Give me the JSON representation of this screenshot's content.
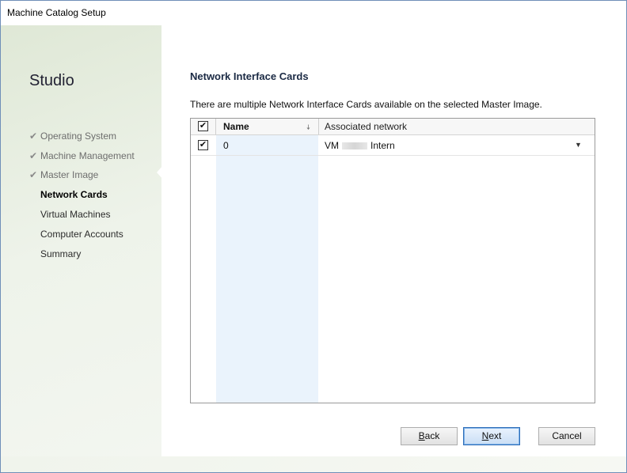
{
  "window": {
    "title": "Machine Catalog Setup"
  },
  "sidebar": {
    "brand": "Studio",
    "steps": [
      {
        "label": "Operating System",
        "state": "done"
      },
      {
        "label": "Machine Management",
        "state": "done"
      },
      {
        "label": "Master Image",
        "state": "done"
      },
      {
        "label": "Network Cards",
        "state": "active"
      },
      {
        "label": "Virtual Machines",
        "state": "future"
      },
      {
        "label": "Computer Accounts",
        "state": "future"
      },
      {
        "label": "Summary",
        "state": "future"
      }
    ]
  },
  "main": {
    "heading": "Network Interface Cards",
    "description": "There are multiple Network Interface Cards available on the selected Master Image.",
    "grid": {
      "columns": [
        "Name",
        "Associated network"
      ],
      "header_checked": true,
      "rows": [
        {
          "checked": true,
          "name": "0",
          "network_prefix": "VM",
          "network_suffix": "Intern"
        }
      ]
    }
  },
  "buttons": {
    "back_mnemonic": "B",
    "back_rest": "ack",
    "next_mnemonic": "N",
    "next_rest": "ext",
    "cancel": "Cancel"
  },
  "icons": {
    "check": "check-icon",
    "sort": "sort-icon",
    "dropdown": "chevron-down-icon"
  }
}
